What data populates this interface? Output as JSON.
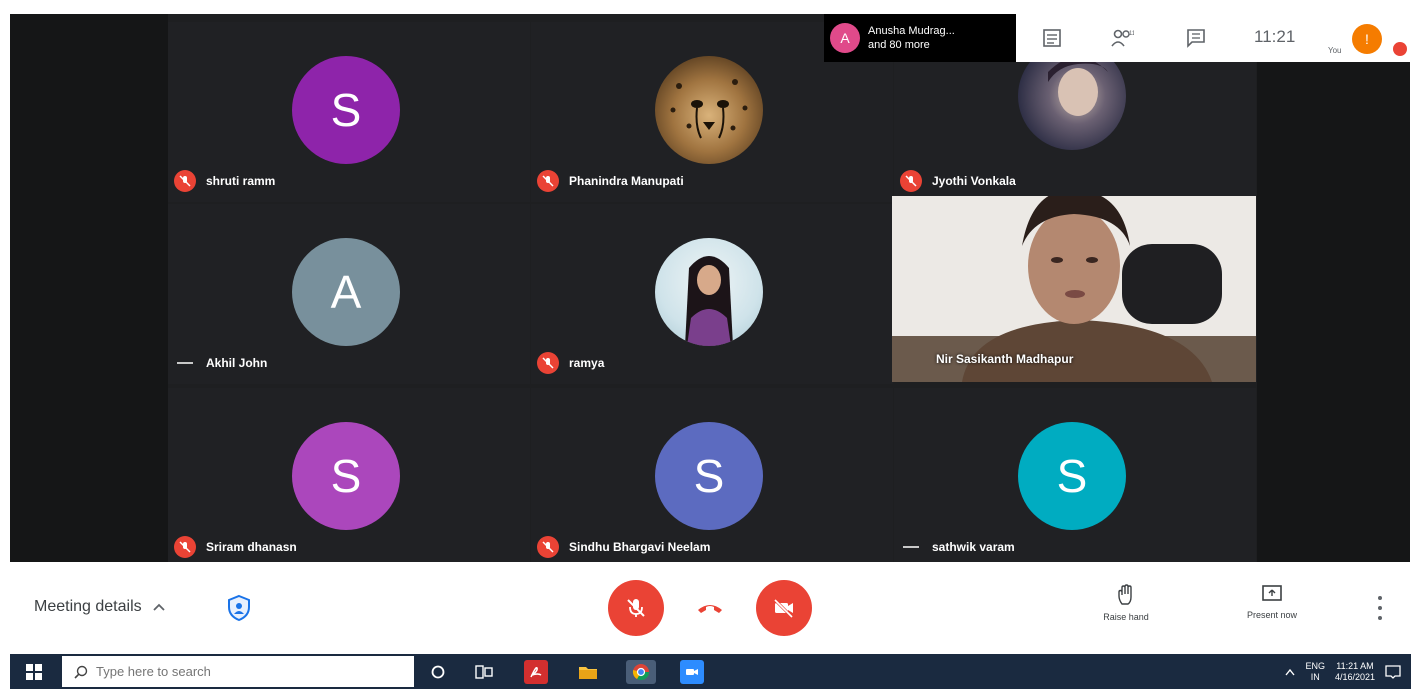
{
  "participants": [
    {
      "name": "shruti ramm",
      "initial": "S",
      "avatar_color": "#8e24aa",
      "muted": true
    },
    {
      "name": "Phanindra Manupati",
      "initial": "",
      "avatar_color": "#8a6a3a",
      "muted": true,
      "photo": "cheetah"
    },
    {
      "name": "Jyothi Vonkala",
      "initial": "",
      "avatar_color": "#3a3d52",
      "muted": true,
      "photo": "portrait"
    },
    {
      "name": "Akhil John",
      "initial": "A",
      "avatar_color": "#78909c",
      "muted": false
    },
    {
      "name": "ramya",
      "initial": "",
      "avatar_color": "#cfe3ea",
      "muted": true,
      "photo": "portrait-light"
    },
    {
      "name": "Sriram dhanasn",
      "initial": "S",
      "avatar_color": "#ab47bc",
      "muted": true
    },
    {
      "name": "Sindhu Bhargavi Neelam",
      "initial": "S",
      "avatar_color": "#5c6bc0",
      "muted": true
    },
    {
      "name": "sathwik varam",
      "initial": "S",
      "avatar_color": "#00acc1",
      "muted": false
    }
  ],
  "video_participant": {
    "name": "Nir Sasikanth Madhapur"
  },
  "notification": {
    "avatar_initial": "A",
    "line1": "Anusha Mudrag...",
    "line2": "and 80 more"
  },
  "top_bar": {
    "clock": "11:21",
    "you_label": "You",
    "self_initial": "!"
  },
  "controls": {
    "meeting_details": "Meeting details",
    "raise_hand": "Raise hand",
    "present_now": "Present now"
  },
  "taskbar": {
    "search_placeholder": "Type here to search",
    "lang_top": "ENG",
    "lang_bottom": "IN",
    "time": "11:21 AM",
    "date": "4/16/2021"
  },
  "colors": {
    "mic_off": "#ea4335",
    "meeting_bg": "#202124",
    "taskbar_bg": "#1a2a40"
  }
}
